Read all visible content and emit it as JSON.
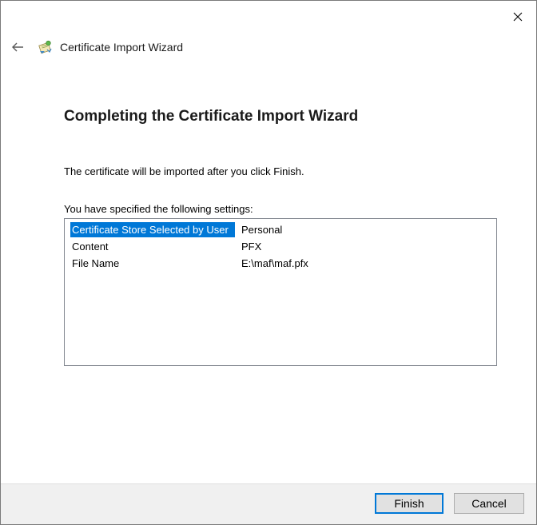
{
  "window": {
    "title": "Certificate Import Wizard",
    "close_icon": "close-icon",
    "back_icon": "back-arrow-icon",
    "wizard_icon": "certificate-icon"
  },
  "page": {
    "heading": "Completing the Certificate Import Wizard",
    "info": "The certificate will be imported after you click Finish.",
    "settings_label": "You have specified the following settings:"
  },
  "settings": [
    {
      "key": "Certificate Store Selected by User",
      "value": "Personal",
      "selected": true
    },
    {
      "key": "Content",
      "value": "PFX",
      "selected": false
    },
    {
      "key": "File Name",
      "value": "E:\\maf\\maf.pfx",
      "selected": false
    }
  ],
  "buttons": {
    "finish": "Finish",
    "cancel": "Cancel"
  },
  "colors": {
    "selection": "#0078d7",
    "footer_bg": "#f0f0f0",
    "primary_border": "#0078d7"
  }
}
